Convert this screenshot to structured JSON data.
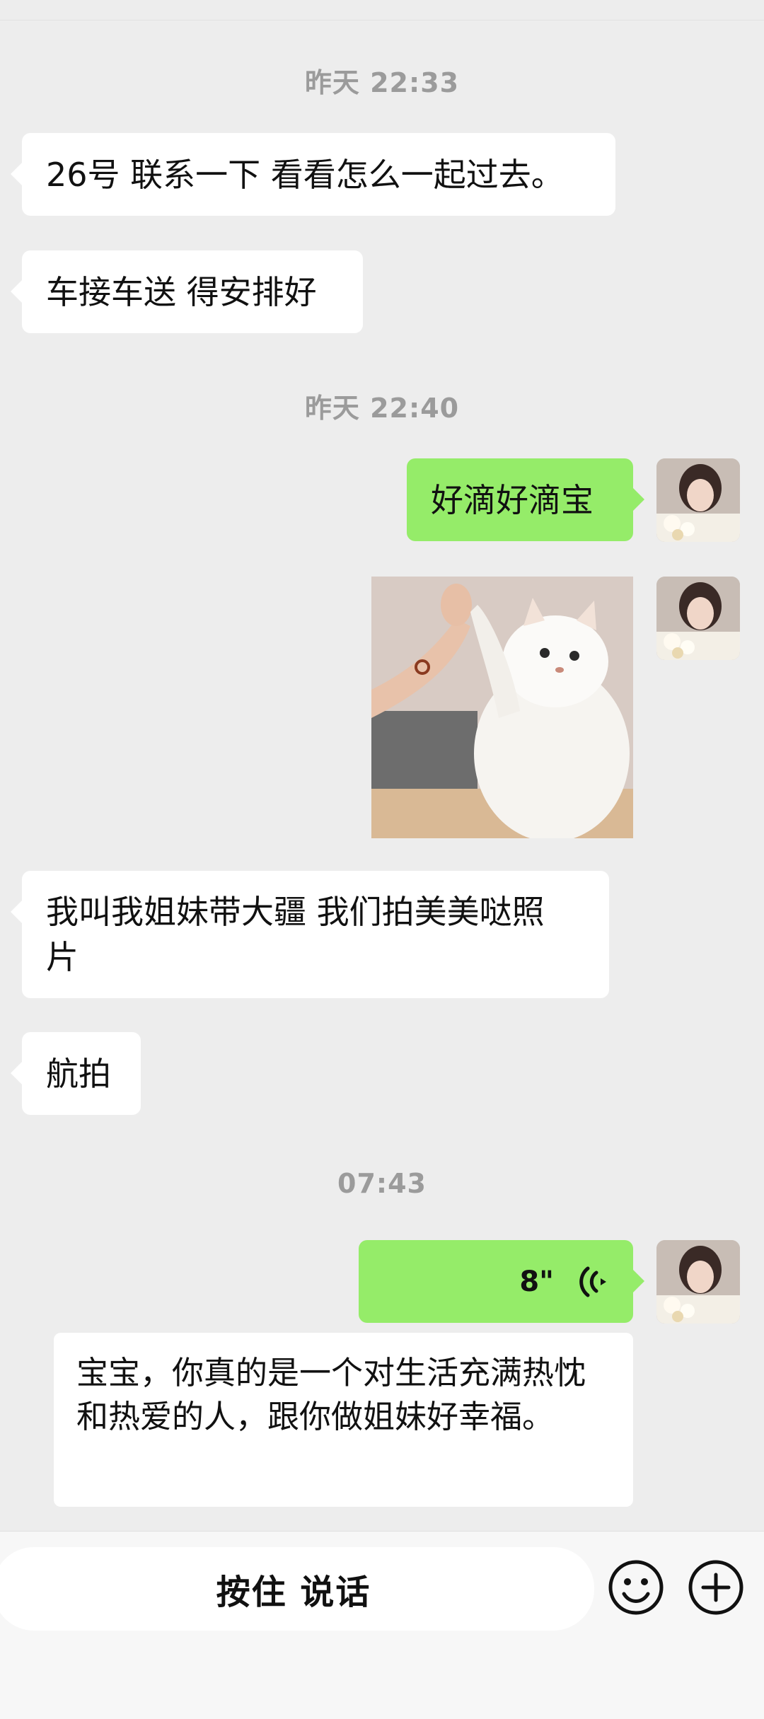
{
  "messages": {
    "time1": "昨天 22:33",
    "m1": "26号 联系一下 看看怎么一起过去。",
    "m2": "车接车送 得安排好",
    "time2": "昨天 22:40",
    "m3": "好滴好滴宝",
    "m4_line1": "我叫我姐妹带大疆 我们拍美美哒照",
    "m4_line2": "片",
    "m5": "航拍",
    "time3": "07:43",
    "voice_seconds": "8\"",
    "transcript": "宝宝，你真的是一个对生活充满热忱和热爱的人，跟你做姐妹好幸福。"
  },
  "input": {
    "hold_to_talk": "按住 说话"
  },
  "icons": {
    "emoji": "emoji-icon",
    "plus": "plus-icon",
    "voice": "voice-wave-icon"
  },
  "colors": {
    "sent_bubble": "#95ec69",
    "received_bubble": "#ffffff",
    "background": "#ededed"
  }
}
